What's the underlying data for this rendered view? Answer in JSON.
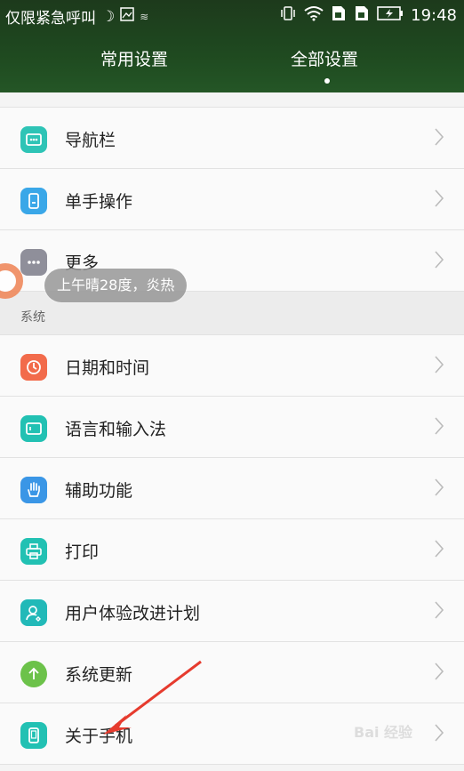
{
  "status_bar": {
    "carrier": "仅限紧急呼叫",
    "time": "19:48"
  },
  "tabs": [
    {
      "label": "常用设置"
    },
    {
      "label": "全部设置"
    }
  ],
  "items": [
    {
      "label": "导航栏",
      "icon": "navigation-bar-icon",
      "color": "#2ec4b6"
    },
    {
      "label": "单手操作",
      "icon": "one-hand-icon",
      "color": "#3aa7e8"
    },
    {
      "label": "更多",
      "icon": "more-icon",
      "color": "#8f8f9a"
    }
  ],
  "section": {
    "label": "系统"
  },
  "system_items": [
    {
      "label": "日期和时间",
      "icon": "clock-icon",
      "color": "#f26b4b"
    },
    {
      "label": "语言和输入法",
      "icon": "keyboard-icon",
      "color": "#22c1b3"
    },
    {
      "label": "辅助功能",
      "icon": "hand-icon",
      "color": "#3a96e6"
    },
    {
      "label": "打印",
      "icon": "printer-icon",
      "color": "#22c1b3"
    },
    {
      "label": "用户体验改进计划",
      "icon": "user-experience-icon",
      "color": "#22b9b8"
    },
    {
      "label": "系统更新",
      "icon": "update-arrow-icon",
      "color": "#6cc24a"
    },
    {
      "label": "关于手机",
      "icon": "phone-icon",
      "color": "#22c1b3"
    }
  ],
  "toast": {
    "text": "上午晴28度，炎热"
  },
  "watermark": {
    "text": "Bai 经验"
  }
}
